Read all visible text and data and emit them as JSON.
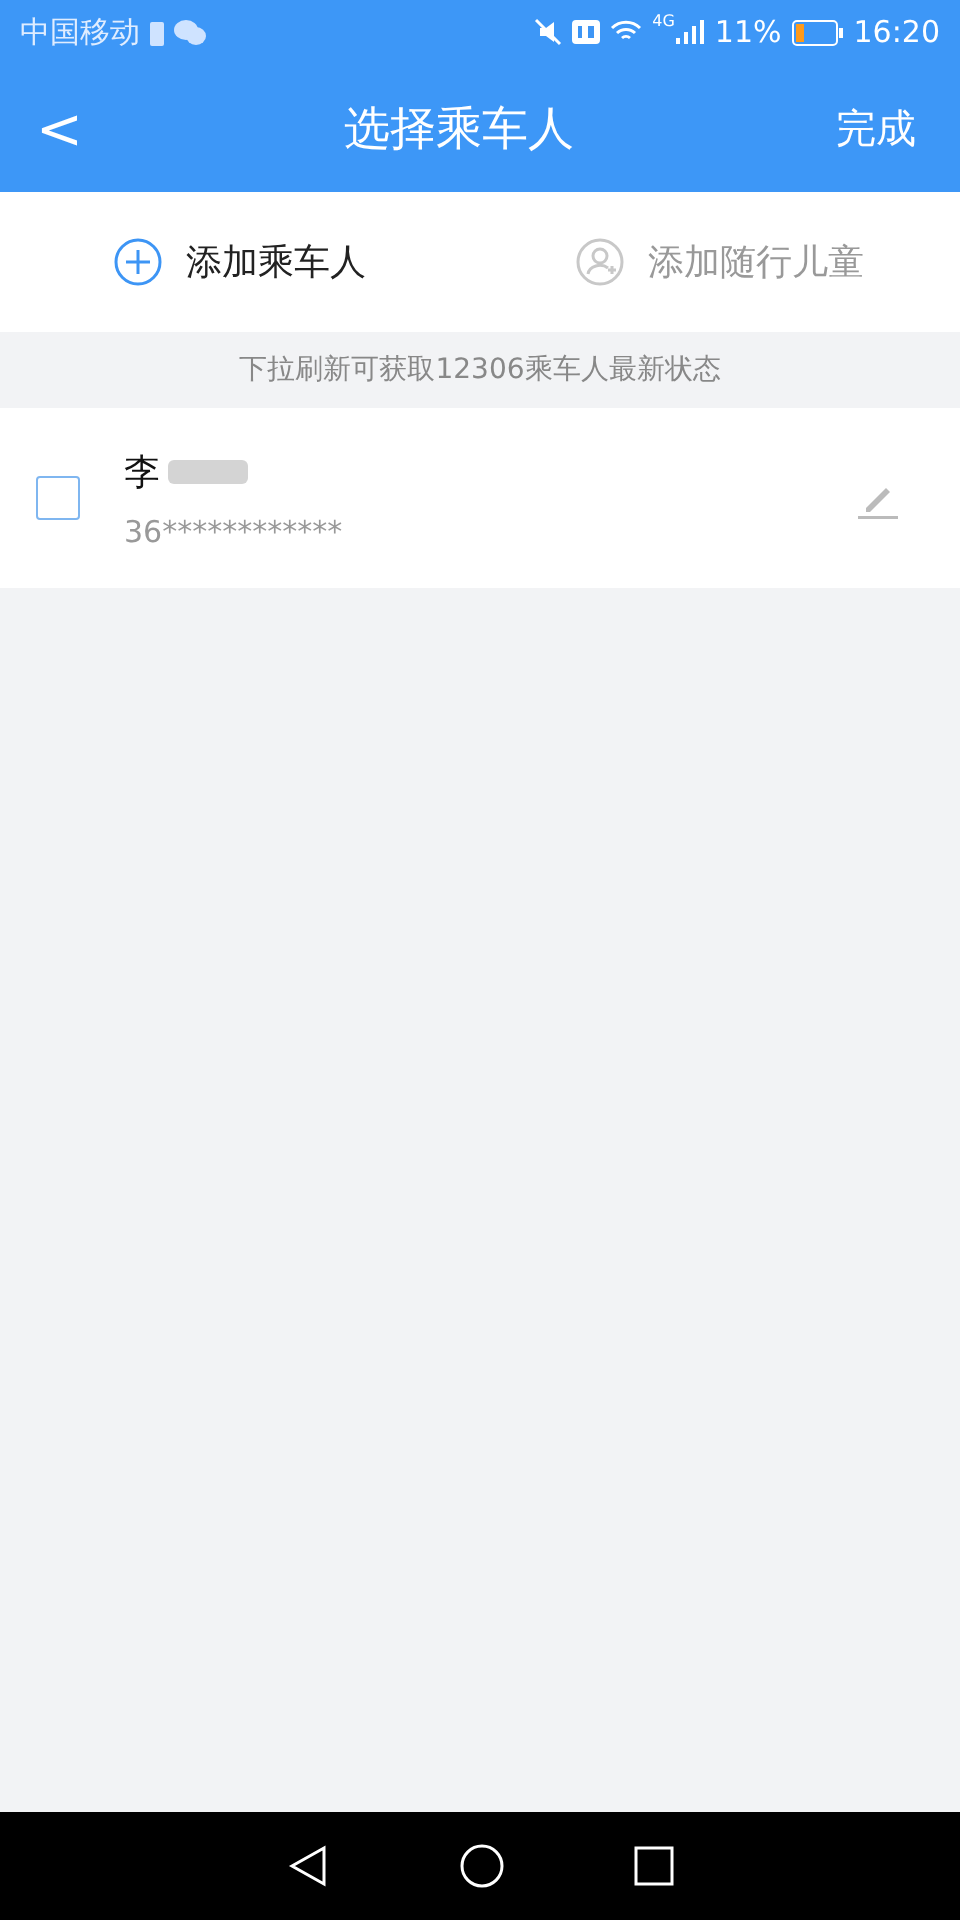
{
  "status_bar": {
    "carrier": "中国移动",
    "network": "4G",
    "battery_text": "11%",
    "time": "16:20"
  },
  "header": {
    "back": "<",
    "title": "选择乘车人",
    "action": "完成"
  },
  "actions": [
    {
      "kind": "add",
      "label": "添加乘车人",
      "disabled": false
    },
    {
      "kind": "child",
      "label": "添加随行儿童",
      "disabled": true
    }
  ],
  "notice": "下拉刷新可获取12306乘车人最新状态",
  "passengers": [
    {
      "name": "李",
      "id_number": "36************",
      "checked": false
    }
  ]
}
